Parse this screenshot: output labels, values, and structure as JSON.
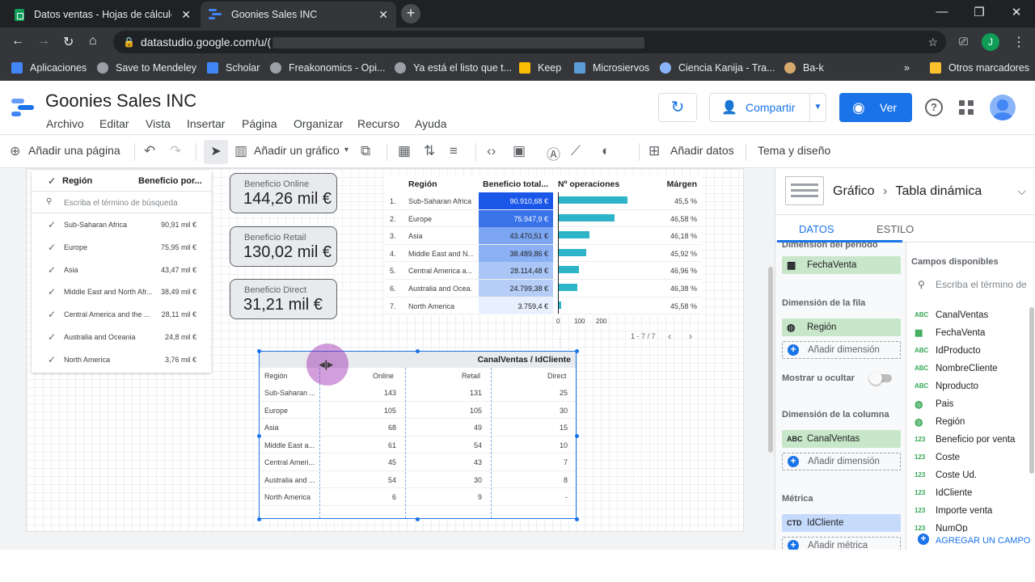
{
  "browser": {
    "tabs": [
      {
        "label": "Datos ventas - Hojas de cálculo de Google",
        "active": false
      },
      {
        "label": "Goonies Sales INC",
        "active": true
      }
    ],
    "url_visible": "datastudio.google.com/u/(",
    "profile_initial": "J",
    "bookmarks": [
      "Aplicaciones",
      "Save to Mendeley",
      "Scholar",
      "Freakonomics - Opi...",
      "Ya está el listo que t...",
      "Keep",
      "Microsiervos",
      "Ciencia Kanija - Tra...",
      "Ba-k"
    ],
    "bookmarks_more": "»",
    "other_bookmarks": "Otros marcadores"
  },
  "app": {
    "title": "Goonies Sales INC",
    "menu": [
      "Archivo",
      "Editar",
      "Vista",
      "Insertar",
      "Página",
      "Organizar",
      "Recurso",
      "Ayuda"
    ],
    "share_label": "Compartir",
    "view_label": "Ver"
  },
  "toolbar": {
    "add_page": "Añadir una página",
    "add_chart": "Añadir un gráfico",
    "add_data": "Añadir datos",
    "theme": "Tema y diseño"
  },
  "filter": {
    "header": "Región",
    "metric_header": "Beneficio por...",
    "search_placeholder": "Escriba el término de búsqueda",
    "rows": [
      {
        "label": "Sub-Saharan Africa",
        "value": "90,91 mil €"
      },
      {
        "label": "Europe",
        "value": "75,95 mil €"
      },
      {
        "label": "Asia",
        "value": "43,47 mil €"
      },
      {
        "label": "Middle East and North Afr...",
        "value": "38,49 mil €"
      },
      {
        "label": "Central America and the ...",
        "value": "28,11 mil €"
      },
      {
        "label": "Australia and Oceania",
        "value": "24,8 mil €"
      },
      {
        "label": "North America",
        "value": "3,76 mil €"
      }
    ]
  },
  "scorecards": [
    {
      "label": "Beneficio Online",
      "value": "144,26 mil €"
    },
    {
      "label": "Beneficio Retail",
      "value": "130,02 mil €"
    },
    {
      "label": "Beneficio Direct",
      "value": "31,21 mil €"
    }
  ],
  "region_table": {
    "headers": [
      "Región",
      "Beneficio total...",
      "Nº operaciones",
      "Márgen"
    ],
    "rows": [
      {
        "n": "1.",
        "region": "Sub-Saharan Africa",
        "benefit": "90.910,68 €",
        "ops": 221,
        "margin": "45,5 %"
      },
      {
        "n": "2.",
        "region": "Europe",
        "benefit": "75.947,9 €",
        "ops": 179,
        "margin": "46,58 %"
      },
      {
        "n": "3.",
        "region": "Asia",
        "benefit": "43.470,51 €",
        "ops": 99,
        "margin": "46,18 %"
      },
      {
        "n": "4.",
        "region": "Middle East and N...",
        "benefit": "38.489,86 €",
        "ops": 89,
        "margin": "45,92 %"
      },
      {
        "n": "5.",
        "region": "Central America a...",
        "benefit": "28.114,48 €",
        "ops": 67,
        "margin": "46,96 %"
      },
      {
        "n": "6.",
        "region": "Australia and Ocea...",
        "benefit": "24.799,38 €",
        "ops": 62,
        "margin": "46,38 %"
      },
      {
        "n": "7.",
        "region": "North America",
        "benefit": "3.759,4 €",
        "ops": 9,
        "margin": "45,58 %"
      }
    ],
    "axis_ticks": [
      "0",
      "100",
      "200"
    ],
    "axis_max": 290,
    "pager": "1 - 7 / 7",
    "heat_colors": [
      "#1a56e8",
      "#3a72ea",
      "#7da6f2",
      "#8bb0f3",
      "#aac6f6",
      "#b6cef7",
      "#e8effd"
    ]
  },
  "pivot": {
    "caption": "CanalVentas / IdCliente",
    "row_header": "Región",
    "columns": [
      "Online",
      "Retail",
      "Direct"
    ],
    "rows": [
      {
        "region": "Sub-Saharan ...",
        "values": [
          "143",
          "131",
          "25"
        ]
      },
      {
        "region": "Europe",
        "values": [
          "105",
          "105",
          "30"
        ]
      },
      {
        "region": "Asia",
        "values": [
          "68",
          "49",
          "15"
        ]
      },
      {
        "region": "Middle East a...",
        "values": [
          "61",
          "54",
          "10"
        ]
      },
      {
        "region": "Central Ameri...",
        "values": [
          "45",
          "43",
          "7"
        ]
      },
      {
        "region": "Australia and ...",
        "values": [
          "54",
          "30",
          "8"
        ]
      },
      {
        "region": "North America",
        "values": [
          "6",
          "9",
          "-"
        ]
      }
    ]
  },
  "panel": {
    "crumb_chart": "Gráfico",
    "crumb_type": "Tabla dinámica",
    "tabs": [
      "DATOS",
      "ESTILO"
    ],
    "period_section": "Dimensión del periodo",
    "period_chip": "FechaVenta",
    "row_section": "Dimensión de la fila",
    "row_chip": "Región",
    "add_dimension": "Añadir dimensión",
    "show_hide": "Mostrar u ocultar",
    "col_section": "Dimensión de la columna",
    "col_chip": "CanalVentas",
    "metric_section": "Métrica",
    "metric_chip": "IdCliente",
    "metric_chip_type": "CTD",
    "add_metric": "Añadir métrica",
    "available_title": "Campos disponibles",
    "available_search": "Escriba el término de",
    "fields": [
      {
        "type": "ABC",
        "name": "CanalVentas"
      },
      {
        "type": "date",
        "name": "FechaVenta"
      },
      {
        "type": "ABC",
        "name": "IdProducto"
      },
      {
        "type": "ABC",
        "name": "NombreCliente"
      },
      {
        "type": "ABC",
        "name": "Nproducto"
      },
      {
        "type": "geo",
        "name": "Pais"
      },
      {
        "type": "geo",
        "name": "Región"
      },
      {
        "type": "123",
        "name": "Beneficio por venta"
      },
      {
        "type": "123",
        "name": "Coste"
      },
      {
        "type": "123",
        "name": "Coste Ud."
      },
      {
        "type": "123",
        "name": "IdCliente"
      },
      {
        "type": "123",
        "name": "Importe venta"
      },
      {
        "type": "123",
        "name": "NumOp"
      }
    ],
    "add_field": "AGREGAR UN CAMPO"
  }
}
